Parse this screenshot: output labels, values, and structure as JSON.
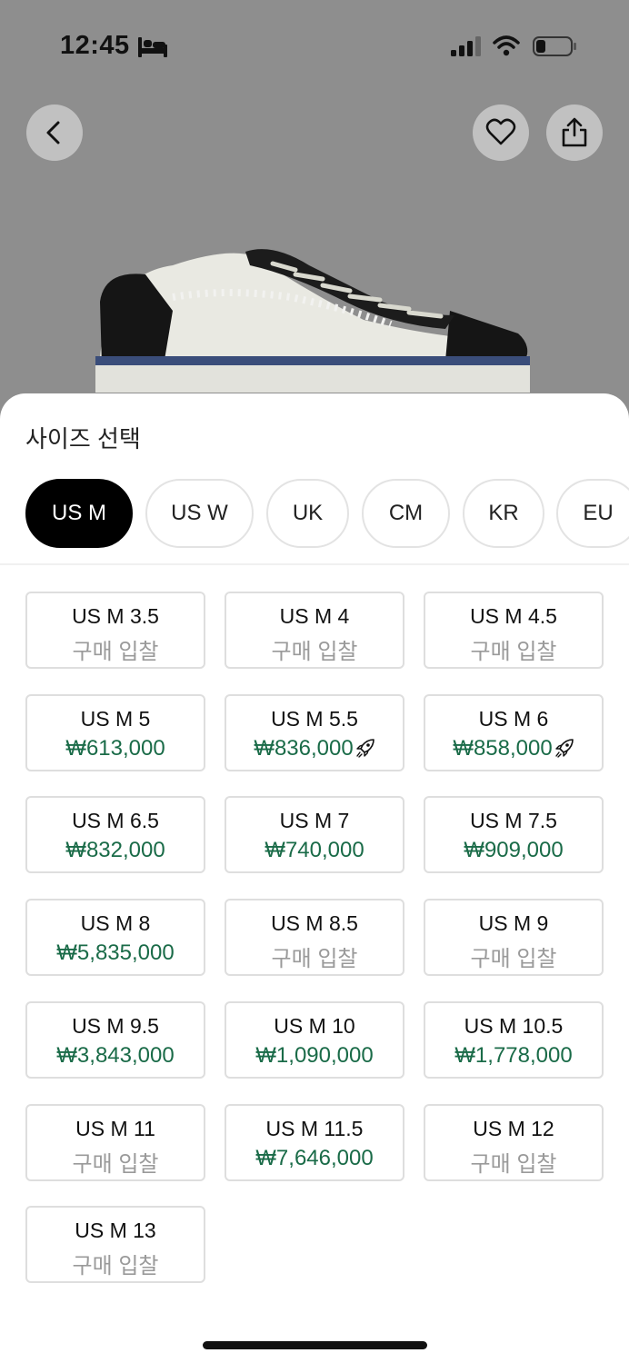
{
  "status_bar": {
    "time": "12:45"
  },
  "colors": {
    "accent_price": "#1a6b48",
    "bid_text": "#9a9a9a",
    "active_tab_bg": "#000000"
  },
  "nav": {
    "back_icon": "chevron-left-icon",
    "favorite_icon": "heart-icon",
    "share_icon": "share-icon"
  },
  "sheet": {
    "title": "사이즈 선택",
    "tabs": [
      {
        "label": "US M",
        "active": true
      },
      {
        "label": "US W",
        "active": false
      },
      {
        "label": "UK",
        "active": false
      },
      {
        "label": "CM",
        "active": false
      },
      {
        "label": "KR",
        "active": false
      },
      {
        "label": "EU",
        "active": false
      }
    ],
    "sizes": [
      {
        "size": "US M 3.5",
        "price": "구매 입찰",
        "is_price": false,
        "fast": false
      },
      {
        "size": "US M 4",
        "price": "구매 입찰",
        "is_price": false,
        "fast": false
      },
      {
        "size": "US M 4.5",
        "price": "구매 입찰",
        "is_price": false,
        "fast": false
      },
      {
        "size": "US M 5",
        "price": "₩613,000",
        "is_price": true,
        "fast": false
      },
      {
        "size": "US M 5.5",
        "price": "₩836,000",
        "is_price": true,
        "fast": true
      },
      {
        "size": "US M 6",
        "price": "₩858,000",
        "is_price": true,
        "fast": true
      },
      {
        "size": "US M 6.5",
        "price": "₩832,000",
        "is_price": true,
        "fast": false
      },
      {
        "size": "US M 7",
        "price": "₩740,000",
        "is_price": true,
        "fast": false
      },
      {
        "size": "US M 7.5",
        "price": "₩909,000",
        "is_price": true,
        "fast": false
      },
      {
        "size": "US M 8",
        "price": "₩5,835,000",
        "is_price": true,
        "fast": false
      },
      {
        "size": "US M 8.5",
        "price": "구매 입찰",
        "is_price": false,
        "fast": false
      },
      {
        "size": "US M 9",
        "price": "구매 입찰",
        "is_price": false,
        "fast": false
      },
      {
        "size": "US M 9.5",
        "price": "₩3,843,000",
        "is_price": true,
        "fast": false
      },
      {
        "size": "US M 10",
        "price": "₩1,090,000",
        "is_price": true,
        "fast": false
      },
      {
        "size": "US M 10.5",
        "price": "₩1,778,000",
        "is_price": true,
        "fast": false
      },
      {
        "size": "US M 11",
        "price": "구매 입찰",
        "is_price": false,
        "fast": false
      },
      {
        "size": "US M 11.5",
        "price": "₩7,646,000",
        "is_price": true,
        "fast": false
      },
      {
        "size": "US M 12",
        "price": "구매 입찰",
        "is_price": false,
        "fast": false
      },
      {
        "size": "US M 13",
        "price": "구매 입찰",
        "is_price": false,
        "fast": false
      }
    ]
  }
}
